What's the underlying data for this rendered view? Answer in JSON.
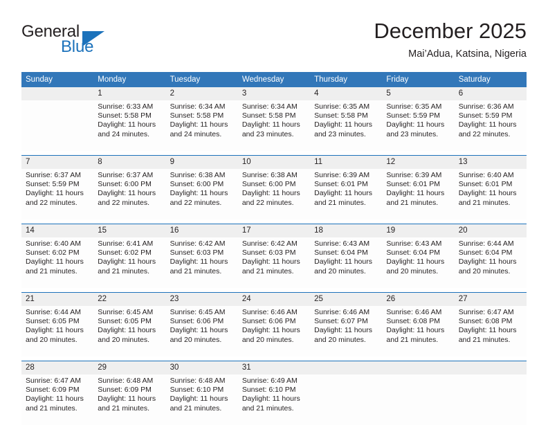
{
  "brand": {
    "name_part1": "General",
    "name_part2": "Blue",
    "accent_color": "#1c72bb"
  },
  "header": {
    "title": "December 2025",
    "location": "Mai’Adua, Katsina, Nigeria"
  },
  "calendar": {
    "header_bg": "#3277b9",
    "daynum_bg": "#efefef",
    "weekdays": [
      "Sunday",
      "Monday",
      "Tuesday",
      "Wednesday",
      "Thursday",
      "Friday",
      "Saturday"
    ],
    "weeks": [
      [
        {
          "day": "",
          "sunrise": "",
          "sunset": "",
          "daylight_1": "",
          "daylight_2": ""
        },
        {
          "day": "1",
          "sunrise": "Sunrise: 6:33 AM",
          "sunset": "Sunset: 5:58 PM",
          "daylight_1": "Daylight: 11 hours",
          "daylight_2": "and 24 minutes."
        },
        {
          "day": "2",
          "sunrise": "Sunrise: 6:34 AM",
          "sunset": "Sunset: 5:58 PM",
          "daylight_1": "Daylight: 11 hours",
          "daylight_2": "and 24 minutes."
        },
        {
          "day": "3",
          "sunrise": "Sunrise: 6:34 AM",
          "sunset": "Sunset: 5:58 PM",
          "daylight_1": "Daylight: 11 hours",
          "daylight_2": "and 23 minutes."
        },
        {
          "day": "4",
          "sunrise": "Sunrise: 6:35 AM",
          "sunset": "Sunset: 5:58 PM",
          "daylight_1": "Daylight: 11 hours",
          "daylight_2": "and 23 minutes."
        },
        {
          "day": "5",
          "sunrise": "Sunrise: 6:35 AM",
          "sunset": "Sunset: 5:59 PM",
          "daylight_1": "Daylight: 11 hours",
          "daylight_2": "and 23 minutes."
        },
        {
          "day": "6",
          "sunrise": "Sunrise: 6:36 AM",
          "sunset": "Sunset: 5:59 PM",
          "daylight_1": "Daylight: 11 hours",
          "daylight_2": "and 22 minutes."
        }
      ],
      [
        {
          "day": "7",
          "sunrise": "Sunrise: 6:37 AM",
          "sunset": "Sunset: 5:59 PM",
          "daylight_1": "Daylight: 11 hours",
          "daylight_2": "and 22 minutes."
        },
        {
          "day": "8",
          "sunrise": "Sunrise: 6:37 AM",
          "sunset": "Sunset: 6:00 PM",
          "daylight_1": "Daylight: 11 hours",
          "daylight_2": "and 22 minutes."
        },
        {
          "day": "9",
          "sunrise": "Sunrise: 6:38 AM",
          "sunset": "Sunset: 6:00 PM",
          "daylight_1": "Daylight: 11 hours",
          "daylight_2": "and 22 minutes."
        },
        {
          "day": "10",
          "sunrise": "Sunrise: 6:38 AM",
          "sunset": "Sunset: 6:00 PM",
          "daylight_1": "Daylight: 11 hours",
          "daylight_2": "and 22 minutes."
        },
        {
          "day": "11",
          "sunrise": "Sunrise: 6:39 AM",
          "sunset": "Sunset: 6:01 PM",
          "daylight_1": "Daylight: 11 hours",
          "daylight_2": "and 21 minutes."
        },
        {
          "day": "12",
          "sunrise": "Sunrise: 6:39 AM",
          "sunset": "Sunset: 6:01 PM",
          "daylight_1": "Daylight: 11 hours",
          "daylight_2": "and 21 minutes."
        },
        {
          "day": "13",
          "sunrise": "Sunrise: 6:40 AM",
          "sunset": "Sunset: 6:01 PM",
          "daylight_1": "Daylight: 11 hours",
          "daylight_2": "and 21 minutes."
        }
      ],
      [
        {
          "day": "14",
          "sunrise": "Sunrise: 6:40 AM",
          "sunset": "Sunset: 6:02 PM",
          "daylight_1": "Daylight: 11 hours",
          "daylight_2": "and 21 minutes."
        },
        {
          "day": "15",
          "sunrise": "Sunrise: 6:41 AM",
          "sunset": "Sunset: 6:02 PM",
          "daylight_1": "Daylight: 11 hours",
          "daylight_2": "and 21 minutes."
        },
        {
          "day": "16",
          "sunrise": "Sunrise: 6:42 AM",
          "sunset": "Sunset: 6:03 PM",
          "daylight_1": "Daylight: 11 hours",
          "daylight_2": "and 21 minutes."
        },
        {
          "day": "17",
          "sunrise": "Sunrise: 6:42 AM",
          "sunset": "Sunset: 6:03 PM",
          "daylight_1": "Daylight: 11 hours",
          "daylight_2": "and 21 minutes."
        },
        {
          "day": "18",
          "sunrise": "Sunrise: 6:43 AM",
          "sunset": "Sunset: 6:04 PM",
          "daylight_1": "Daylight: 11 hours",
          "daylight_2": "and 20 minutes."
        },
        {
          "day": "19",
          "sunrise": "Sunrise: 6:43 AM",
          "sunset": "Sunset: 6:04 PM",
          "daylight_1": "Daylight: 11 hours",
          "daylight_2": "and 20 minutes."
        },
        {
          "day": "20",
          "sunrise": "Sunrise: 6:44 AM",
          "sunset": "Sunset: 6:04 PM",
          "daylight_1": "Daylight: 11 hours",
          "daylight_2": "and 20 minutes."
        }
      ],
      [
        {
          "day": "21",
          "sunrise": "Sunrise: 6:44 AM",
          "sunset": "Sunset: 6:05 PM",
          "daylight_1": "Daylight: 11 hours",
          "daylight_2": "and 20 minutes."
        },
        {
          "day": "22",
          "sunrise": "Sunrise: 6:45 AM",
          "sunset": "Sunset: 6:05 PM",
          "daylight_1": "Daylight: 11 hours",
          "daylight_2": "and 20 minutes."
        },
        {
          "day": "23",
          "sunrise": "Sunrise: 6:45 AM",
          "sunset": "Sunset: 6:06 PM",
          "daylight_1": "Daylight: 11 hours",
          "daylight_2": "and 20 minutes."
        },
        {
          "day": "24",
          "sunrise": "Sunrise: 6:46 AM",
          "sunset": "Sunset: 6:06 PM",
          "daylight_1": "Daylight: 11 hours",
          "daylight_2": "and 20 minutes."
        },
        {
          "day": "25",
          "sunrise": "Sunrise: 6:46 AM",
          "sunset": "Sunset: 6:07 PM",
          "daylight_1": "Daylight: 11 hours",
          "daylight_2": "and 20 minutes."
        },
        {
          "day": "26",
          "sunrise": "Sunrise: 6:46 AM",
          "sunset": "Sunset: 6:08 PM",
          "daylight_1": "Daylight: 11 hours",
          "daylight_2": "and 21 minutes."
        },
        {
          "day": "27",
          "sunrise": "Sunrise: 6:47 AM",
          "sunset": "Sunset: 6:08 PM",
          "daylight_1": "Daylight: 11 hours",
          "daylight_2": "and 21 minutes."
        }
      ],
      [
        {
          "day": "28",
          "sunrise": "Sunrise: 6:47 AM",
          "sunset": "Sunset: 6:09 PM",
          "daylight_1": "Daylight: 11 hours",
          "daylight_2": "and 21 minutes."
        },
        {
          "day": "29",
          "sunrise": "Sunrise: 6:48 AM",
          "sunset": "Sunset: 6:09 PM",
          "daylight_1": "Daylight: 11 hours",
          "daylight_2": "and 21 minutes."
        },
        {
          "day": "30",
          "sunrise": "Sunrise: 6:48 AM",
          "sunset": "Sunset: 6:10 PM",
          "daylight_1": "Daylight: 11 hours",
          "daylight_2": "and 21 minutes."
        },
        {
          "day": "31",
          "sunrise": "Sunrise: 6:49 AM",
          "sunset": "Sunset: 6:10 PM",
          "daylight_1": "Daylight: 11 hours",
          "daylight_2": "and 21 minutes."
        },
        {
          "day": "",
          "sunrise": "",
          "sunset": "",
          "daylight_1": "",
          "daylight_2": ""
        },
        {
          "day": "",
          "sunrise": "",
          "sunset": "",
          "daylight_1": "",
          "daylight_2": ""
        },
        {
          "day": "",
          "sunrise": "",
          "sunset": "",
          "daylight_1": "",
          "daylight_2": ""
        }
      ]
    ]
  }
}
